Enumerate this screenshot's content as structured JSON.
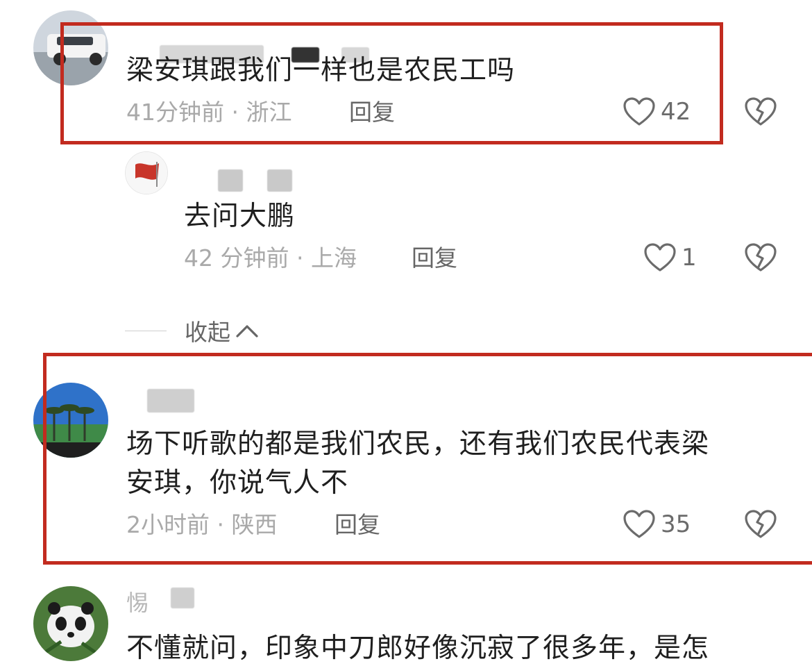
{
  "comments": [
    {
      "text": "梁安琪跟我们一样也是农民工吗",
      "time": "41分钟前",
      "location": "浙江",
      "reply_label": "回复",
      "likes": "42"
    },
    {
      "text": "去问大鹏",
      "time": "42 分钟前",
      "location": "上海",
      "reply_label": "回复",
      "likes": "1"
    },
    {
      "text_line1": "场下听歌的都是我们农民，还有我们农民代表梁",
      "text_line2": "安琪，你说气人不",
      "time": "2小时前",
      "location": "陕西",
      "reply_label": "回复",
      "likes": "35"
    },
    {
      "name_fragment": "惕",
      "text": "不懂就问，印象中刀郎好像沉寂了很多年，是怎"
    }
  ],
  "collapse_label": "收起",
  "separator": "·",
  "colors": {
    "highlight_border": "#c22b1f",
    "meta_text": "#a9a9a9",
    "body_text": "#1f1f1f"
  },
  "icons": [
    "heart-icon",
    "broken-heart-icon",
    "chevron-up-icon"
  ]
}
